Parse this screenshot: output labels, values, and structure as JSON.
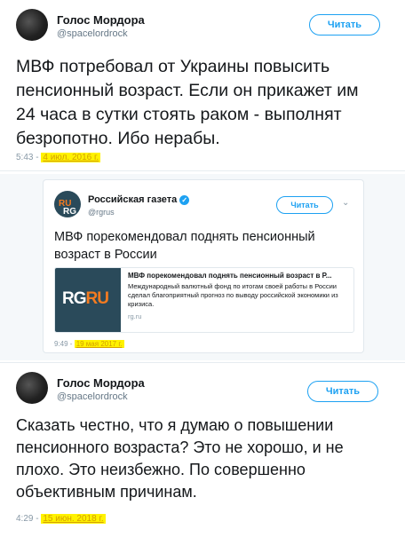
{
  "tweet1": {
    "name": "Голос Мордора",
    "handle": "@spacelordrock",
    "follow_label": "Читать",
    "text": "МВФ потребовал от Украины повысить пенсионный возраст. Если он прикажет им 24 часа в сутки стоять раком - выполнят безропотно. Ибо нерабы.",
    "time": "5:43",
    "date": "4 июл. 2016 г."
  },
  "tweet2": {
    "name": "Российская газета",
    "handle": "@rgrus",
    "follow_label": "Читать",
    "avatar_text": "RG",
    "avatar_text_accent": "RU",
    "text": "МВФ порекомендовал поднять пенсионный возраст в России",
    "card": {
      "logo": "RG",
      "logo_accent": "RU",
      "title": "МВФ порекомендовал поднять пенсионный возраст в Р...",
      "description": "Международный валютный фонд по итогам своей работы в России сделал благоприятный прогноз по выводу российской экономики из кризиса.",
      "domain": "rg.ru"
    },
    "time": "9:49",
    "date": "19 мая 2017 г."
  },
  "tweet3": {
    "name": "Голос Мордора",
    "handle": "@spacelordrock",
    "follow_label": "Читать",
    "text": "Сказать честно, что я думаю о повышении пенсионного возраста? Это не хорошо, и не плохо. Это неизбежно. По совершенно объективным причинам.",
    "time": "4:29",
    "date": "15 июн. 2018 г."
  },
  "icons": {
    "verified": "verified-badge-icon",
    "chevron": "chevron-down-icon"
  },
  "colors": {
    "twitter_blue": "#1da1f2",
    "highlight": "#fff200",
    "rg_orange": "#f47b20"
  }
}
